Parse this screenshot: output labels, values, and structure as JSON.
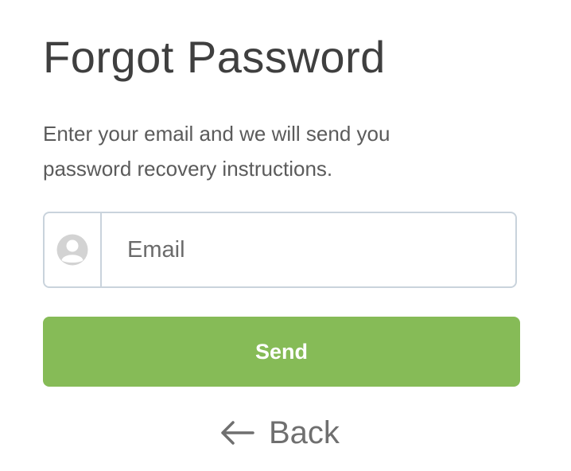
{
  "page": {
    "title": "Forgot Password",
    "description": "Enter your email and we will send you password recovery instructions."
  },
  "form": {
    "email_placeholder": "Email",
    "email_value": "",
    "email_icon": "user-avatar-icon",
    "send_label": "Send"
  },
  "back": {
    "label": "Back",
    "icon": "arrow-left-icon"
  },
  "colors": {
    "title_text": "#3f3f3f",
    "body_text": "#5b5b5b",
    "input_border": "#c9d3dc",
    "send_button": "#86bb57",
    "send_text": "#ffffff",
    "back_text": "#6f6f6f",
    "avatar_icon": "#d3d3d3"
  }
}
